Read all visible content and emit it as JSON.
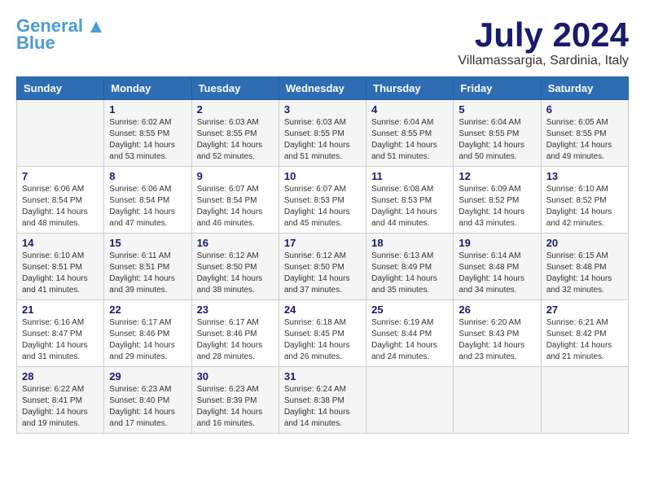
{
  "logo": {
    "name1": "General",
    "name2": "Blue",
    "tagline": ""
  },
  "title": {
    "month_year": "July 2024",
    "location": "Villamassargia, Sardinia, Italy"
  },
  "weekdays": [
    "Sunday",
    "Monday",
    "Tuesday",
    "Wednesday",
    "Thursday",
    "Friday",
    "Saturday"
  ],
  "weeks": [
    [
      {
        "day": "",
        "sunrise": "",
        "sunset": "",
        "daylight": ""
      },
      {
        "day": "1",
        "sunrise": "Sunrise: 6:02 AM",
        "sunset": "Sunset: 8:55 PM",
        "daylight": "Daylight: 14 hours and 53 minutes."
      },
      {
        "day": "2",
        "sunrise": "Sunrise: 6:03 AM",
        "sunset": "Sunset: 8:55 PM",
        "daylight": "Daylight: 14 hours and 52 minutes."
      },
      {
        "day": "3",
        "sunrise": "Sunrise: 6:03 AM",
        "sunset": "Sunset: 8:55 PM",
        "daylight": "Daylight: 14 hours and 51 minutes."
      },
      {
        "day": "4",
        "sunrise": "Sunrise: 6:04 AM",
        "sunset": "Sunset: 8:55 PM",
        "daylight": "Daylight: 14 hours and 51 minutes."
      },
      {
        "day": "5",
        "sunrise": "Sunrise: 6:04 AM",
        "sunset": "Sunset: 8:55 PM",
        "daylight": "Daylight: 14 hours and 50 minutes."
      },
      {
        "day": "6",
        "sunrise": "Sunrise: 6:05 AM",
        "sunset": "Sunset: 8:55 PM",
        "daylight": "Daylight: 14 hours and 49 minutes."
      }
    ],
    [
      {
        "day": "7",
        "sunrise": "Sunrise: 6:06 AM",
        "sunset": "Sunset: 8:54 PM",
        "daylight": "Daylight: 14 hours and 48 minutes."
      },
      {
        "day": "8",
        "sunrise": "Sunrise: 6:06 AM",
        "sunset": "Sunset: 8:54 PM",
        "daylight": "Daylight: 14 hours and 47 minutes."
      },
      {
        "day": "9",
        "sunrise": "Sunrise: 6:07 AM",
        "sunset": "Sunset: 8:54 PM",
        "daylight": "Daylight: 14 hours and 46 minutes."
      },
      {
        "day": "10",
        "sunrise": "Sunrise: 6:07 AM",
        "sunset": "Sunset: 8:53 PM",
        "daylight": "Daylight: 14 hours and 45 minutes."
      },
      {
        "day": "11",
        "sunrise": "Sunrise: 6:08 AM",
        "sunset": "Sunset: 8:53 PM",
        "daylight": "Daylight: 14 hours and 44 minutes."
      },
      {
        "day": "12",
        "sunrise": "Sunrise: 6:09 AM",
        "sunset": "Sunset: 8:52 PM",
        "daylight": "Daylight: 14 hours and 43 minutes."
      },
      {
        "day": "13",
        "sunrise": "Sunrise: 6:10 AM",
        "sunset": "Sunset: 8:52 PM",
        "daylight": "Daylight: 14 hours and 42 minutes."
      }
    ],
    [
      {
        "day": "14",
        "sunrise": "Sunrise: 6:10 AM",
        "sunset": "Sunset: 8:51 PM",
        "daylight": "Daylight: 14 hours and 41 minutes."
      },
      {
        "day": "15",
        "sunrise": "Sunrise: 6:11 AM",
        "sunset": "Sunset: 8:51 PM",
        "daylight": "Daylight: 14 hours and 39 minutes."
      },
      {
        "day": "16",
        "sunrise": "Sunrise: 6:12 AM",
        "sunset": "Sunset: 8:50 PM",
        "daylight": "Daylight: 14 hours and 38 minutes."
      },
      {
        "day": "17",
        "sunrise": "Sunrise: 6:12 AM",
        "sunset": "Sunset: 8:50 PM",
        "daylight": "Daylight: 14 hours and 37 minutes."
      },
      {
        "day": "18",
        "sunrise": "Sunrise: 6:13 AM",
        "sunset": "Sunset: 8:49 PM",
        "daylight": "Daylight: 14 hours and 35 minutes."
      },
      {
        "day": "19",
        "sunrise": "Sunrise: 6:14 AM",
        "sunset": "Sunset: 8:48 PM",
        "daylight": "Daylight: 14 hours and 34 minutes."
      },
      {
        "day": "20",
        "sunrise": "Sunrise: 6:15 AM",
        "sunset": "Sunset: 8:48 PM",
        "daylight": "Daylight: 14 hours and 32 minutes."
      }
    ],
    [
      {
        "day": "21",
        "sunrise": "Sunrise: 6:16 AM",
        "sunset": "Sunset: 8:47 PM",
        "daylight": "Daylight: 14 hours and 31 minutes."
      },
      {
        "day": "22",
        "sunrise": "Sunrise: 6:17 AM",
        "sunset": "Sunset: 8:46 PM",
        "daylight": "Daylight: 14 hours and 29 minutes."
      },
      {
        "day": "23",
        "sunrise": "Sunrise: 6:17 AM",
        "sunset": "Sunset: 8:46 PM",
        "daylight": "Daylight: 14 hours and 28 minutes."
      },
      {
        "day": "24",
        "sunrise": "Sunrise: 6:18 AM",
        "sunset": "Sunset: 8:45 PM",
        "daylight": "Daylight: 14 hours and 26 minutes."
      },
      {
        "day": "25",
        "sunrise": "Sunrise: 6:19 AM",
        "sunset": "Sunset: 8:44 PM",
        "daylight": "Daylight: 14 hours and 24 minutes."
      },
      {
        "day": "26",
        "sunrise": "Sunrise: 6:20 AM",
        "sunset": "Sunset: 8:43 PM",
        "daylight": "Daylight: 14 hours and 23 minutes."
      },
      {
        "day": "27",
        "sunrise": "Sunrise: 6:21 AM",
        "sunset": "Sunset: 8:42 PM",
        "daylight": "Daylight: 14 hours and 21 minutes."
      }
    ],
    [
      {
        "day": "28",
        "sunrise": "Sunrise: 6:22 AM",
        "sunset": "Sunset: 8:41 PM",
        "daylight": "Daylight: 14 hours and 19 minutes."
      },
      {
        "day": "29",
        "sunrise": "Sunrise: 6:23 AM",
        "sunset": "Sunset: 8:40 PM",
        "daylight": "Daylight: 14 hours and 17 minutes."
      },
      {
        "day": "30",
        "sunrise": "Sunrise: 6:23 AM",
        "sunset": "Sunset: 8:39 PM",
        "daylight": "Daylight: 14 hours and 16 minutes."
      },
      {
        "day": "31",
        "sunrise": "Sunrise: 6:24 AM",
        "sunset": "Sunset: 8:38 PM",
        "daylight": "Daylight: 14 hours and 14 minutes."
      },
      {
        "day": "",
        "sunrise": "",
        "sunset": "",
        "daylight": ""
      },
      {
        "day": "",
        "sunrise": "",
        "sunset": "",
        "daylight": ""
      },
      {
        "day": "",
        "sunrise": "",
        "sunset": "",
        "daylight": ""
      }
    ]
  ]
}
